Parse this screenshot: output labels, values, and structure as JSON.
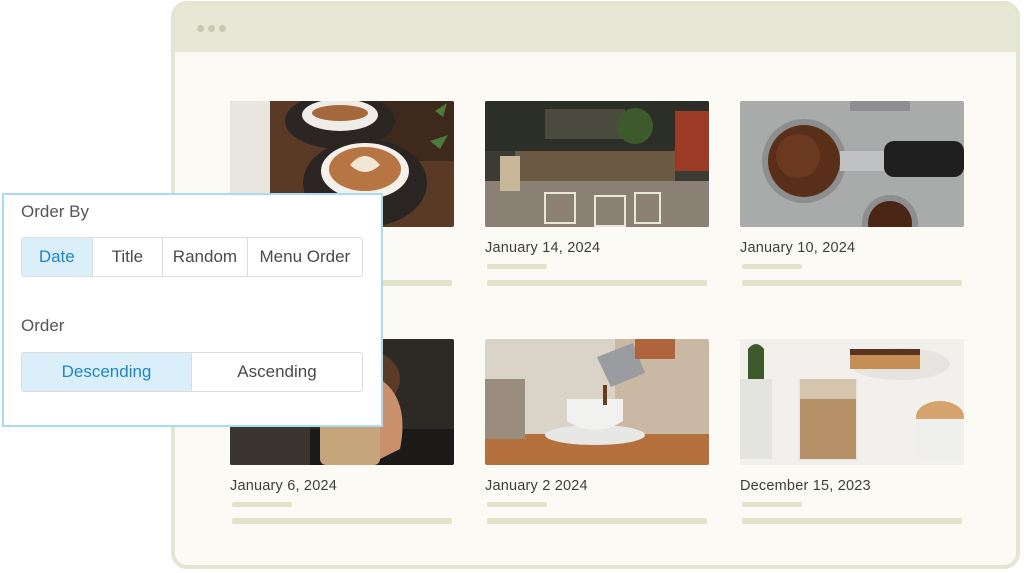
{
  "colors": {
    "frame_border": "#e4e6d3",
    "frame_bg": "#fbfaf4",
    "accent": "#1f86c2",
    "active_bg": "#daeffa",
    "panel_border": "#a8dcf0"
  },
  "posts": [
    {
      "date": "",
      "image": "latte-art-cups-photo"
    },
    {
      "date": "January 14, 2024",
      "image": "cafe-interior-photo"
    },
    {
      "date": "January 10, 2024",
      "image": "ground-coffee-portafilter-photo"
    },
    {
      "date": "January 6, 2024",
      "image": "hand-holding-coffee-photo"
    },
    {
      "date": "January 2 2024",
      "image": "pouring-coffee-cup-photo"
    },
    {
      "date": "December 15, 2023",
      "image": "iced-coffee-and-cake-photo"
    }
  ],
  "order_panel": {
    "order_by_label": "Order By",
    "order_by_options": [
      "Date",
      "Title",
      "Random",
      "Menu Order"
    ],
    "order_by_selected": "Date",
    "order_label": "Order",
    "order_options": [
      "Descending",
      "Ascending"
    ],
    "order_selected": "Descending"
  }
}
